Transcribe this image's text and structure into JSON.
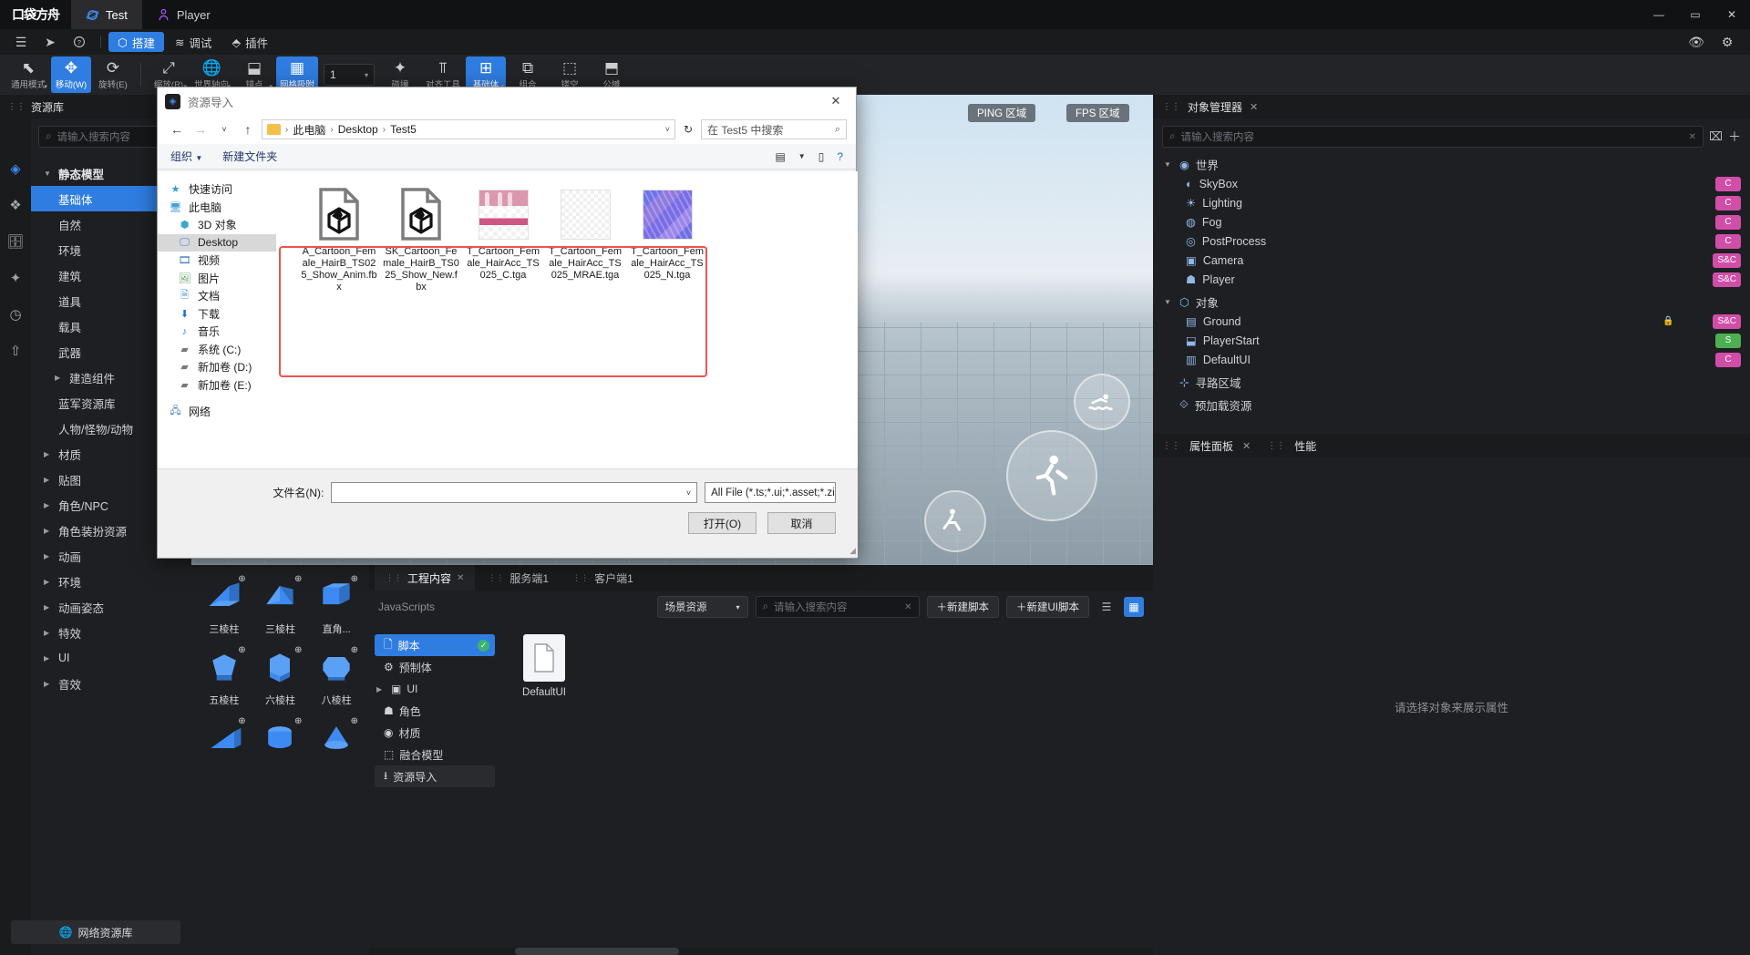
{
  "titlebar": {
    "brand": "口袋方舟",
    "tabs": [
      {
        "label": "Test",
        "icon": "planet-icon",
        "active": true
      },
      {
        "label": "Player",
        "icon": "avatar-icon",
        "active": false
      }
    ],
    "minimize": "—",
    "maximize": "▭",
    "close": "✕"
  },
  "menubar": {
    "hamburger": "☰",
    "send": "➤",
    "help": "?",
    "items": [
      {
        "label": "搭建",
        "icon": "cube-icon",
        "active": true
      },
      {
        "label": "调试",
        "icon": "layers-icon",
        "active": false
      },
      {
        "label": "插件",
        "icon": "plugin-icon",
        "active": false
      }
    ],
    "right": [
      "👁",
      "⚙"
    ]
  },
  "toolbar": {
    "tools": [
      {
        "caption": "通用模式",
        "glyph": "⬉",
        "selected": false,
        "caret": true
      },
      {
        "caption": "移动(W)",
        "glyph": "✥",
        "selected": true,
        "caret": false
      },
      {
        "caption": "旋转(E)",
        "glyph": "⟳",
        "selected": false,
        "caret": false
      },
      {
        "caption": "缩放(R)",
        "glyph": "⤢",
        "selected": false,
        "caret": true
      },
      {
        "caption": "世界轴向",
        "glyph": "🌐",
        "selected": false,
        "caret": true
      },
      {
        "caption": "锚点",
        "glyph": "⬓",
        "selected": false,
        "caret": true
      },
      {
        "caption": "网格吸附",
        "glyph": "▦",
        "selected": true,
        "caret": false
      },
      {
        "caption": "碰撞",
        "glyph": "✦",
        "selected": false,
        "caret": false
      },
      {
        "caption": "对齐工具",
        "glyph": "⫪",
        "selected": false,
        "caret": false
      },
      {
        "caption": "基础体",
        "glyph": "⊞",
        "selected": true,
        "caret": true
      },
      {
        "caption": "组合",
        "glyph": "⧉",
        "selected": false,
        "caret": false
      },
      {
        "caption": "镂空",
        "glyph": "⬚",
        "selected": false,
        "caret": false
      },
      {
        "caption": "公摊",
        "glyph": "⬒",
        "selected": false,
        "caret": false
      }
    ],
    "grid_value": "1"
  },
  "library": {
    "tab_title": "资源库",
    "tab_close": "✕",
    "search_placeholder": "请输入搜索内容",
    "collapse": "«",
    "rail_icons": [
      "cube-stack-icon",
      "grid-icon",
      "briefcase-icon",
      "star-icon",
      "clock-icon",
      "upload-icon"
    ],
    "items": [
      {
        "label": "静态模型",
        "type": "head",
        "tri": "▼"
      },
      {
        "label": "基础体",
        "type": "sel"
      },
      {
        "label": "自然",
        "type": "row"
      },
      {
        "label": "环境",
        "type": "row"
      },
      {
        "label": "建筑",
        "type": "row"
      },
      {
        "label": "道具",
        "type": "row"
      },
      {
        "label": "载具",
        "type": "row"
      },
      {
        "label": "武器",
        "type": "row"
      },
      {
        "label": "建造组件",
        "type": "sub",
        "tri": "▶"
      },
      {
        "label": "蓝军资源库",
        "type": "row"
      },
      {
        "label": "人物/怪物/动物",
        "type": "row"
      },
      {
        "label": "材质",
        "type": "row",
        "tri": "▶"
      },
      {
        "label": "贴图",
        "type": "row",
        "tri": "▶"
      },
      {
        "label": "角色/NPC",
        "type": "row",
        "tri": "▶"
      },
      {
        "label": "角色装扮资源",
        "type": "row",
        "tri": "▶"
      },
      {
        "label": "动画",
        "type": "row",
        "tri": "▶"
      },
      {
        "label": "环境",
        "type": "row",
        "tri": "▶"
      },
      {
        "label": "动画姿态",
        "type": "row",
        "tri": "▶"
      },
      {
        "label": "特效",
        "type": "row",
        "tri": "▶"
      },
      {
        "label": "UI",
        "type": "row",
        "tri": "▶"
      },
      {
        "label": "音效",
        "type": "row",
        "tri": "▶"
      }
    ],
    "net_library": "网络资源库",
    "net_icon": "globe-icon"
  },
  "viewport": {
    "badges": [
      {
        "label": "PING 区域"
      },
      {
        "label": "FPS 区域"
      }
    ],
    "gizmos": [
      "swim-icon",
      "run-icon",
      "crouch-icon"
    ]
  },
  "asset_grid": {
    "cells": [
      {
        "name": "三棱柱",
        "shape": "wedge"
      },
      {
        "name": "三棱柱",
        "shape": "wedge2"
      },
      {
        "name": "直角...",
        "shape": "corner"
      },
      {
        "name": "五棱柱",
        "shape": "penta"
      },
      {
        "name": "六棱柱",
        "shape": "hexa"
      },
      {
        "name": "八棱柱",
        "shape": "octa"
      },
      {
        "name": "",
        "shape": "ramp"
      },
      {
        "name": "",
        "shape": "cyl"
      },
      {
        "name": "",
        "shape": "cone"
      }
    ],
    "zoom_icon": "magnifier-plus-icon"
  },
  "dock": {
    "tabs": [
      {
        "label": "工程内容",
        "active": true,
        "close": "✕"
      },
      {
        "label": "服务端1",
        "active": false
      },
      {
        "label": "客户端1",
        "active": false
      }
    ],
    "subtitle": "JavaScripts",
    "scope_select": "场景资源",
    "search_placeholder": "请输入搜索内容",
    "new_script": "＋新建脚本",
    "new_ui_script": "＋新建UI脚本",
    "view_list_icon": "list-view-icon",
    "view_grid_icon": "grid-view-icon",
    "tree": [
      {
        "label": "脚本",
        "icon": "file-icon",
        "selected": true,
        "check": "✓"
      },
      {
        "label": "预制体",
        "icon": "gear-icon"
      },
      {
        "label": "UI",
        "icon": "ui-icon",
        "tri": "▶"
      },
      {
        "label": "角色",
        "icon": "person-icon"
      },
      {
        "label": "材质",
        "icon": "material-icon"
      },
      {
        "label": "融合模型",
        "icon": "merge-icon"
      },
      {
        "label": "资源导入",
        "icon": "import-icon",
        "highlight": true
      }
    ],
    "files": [
      {
        "name": "DefaultUI",
        "icon": "file-icon"
      }
    ]
  },
  "object_manager": {
    "title": "对象管理器",
    "close": "✕",
    "search_placeholder": "请输入搜索内容",
    "clear": "✕",
    "filter_icon": "filter-icon",
    "add_icon": "plus-icon",
    "rows": [
      {
        "label": "世界",
        "tri": "▼",
        "depth": 0,
        "icon": "globe-icon",
        "tag": "",
        "tagcolor": ""
      },
      {
        "label": "SkyBox",
        "depth": 1,
        "icon": "sky-icon",
        "tag": "C",
        "tagcolor": "#d14ea8"
      },
      {
        "label": "Lighting",
        "depth": 1,
        "icon": "light-icon",
        "tag": "C",
        "tagcolor": "#d14ea8"
      },
      {
        "label": "Fog",
        "depth": 1,
        "icon": "fog-icon",
        "tag": "C",
        "tagcolor": "#d14ea8"
      },
      {
        "label": "PostProcess",
        "depth": 1,
        "icon": "post-icon",
        "tag": "C",
        "tagcolor": "#d14ea8"
      },
      {
        "label": "Camera",
        "depth": 1,
        "icon": "camera-icon",
        "tag": "S&C",
        "tagcolor": "#d14ea8"
      },
      {
        "label": "Player",
        "depth": 1,
        "icon": "player-icon",
        "tag": "S&C",
        "tagcolor": "#d14ea8"
      },
      {
        "label": "对象",
        "tri": "▼",
        "depth": 0,
        "icon": "cube-icon",
        "tag": "",
        "tagcolor": ""
      },
      {
        "label": "Ground",
        "depth": 1,
        "icon": "ground-icon",
        "tag": "S&C",
        "tagcolor": "#d14ea8",
        "lock": "🔒"
      },
      {
        "label": "PlayerStart",
        "depth": 1,
        "icon": "start-icon",
        "tag": "S",
        "tagcolor": "#4caf50"
      },
      {
        "label": "DefaultUI",
        "depth": 1,
        "icon": "ui-icon",
        "tag": "C",
        "tagcolor": "#d14ea8"
      },
      {
        "label": "寻路区域",
        "depth": 0,
        "icon": "nav-icon",
        "tag": "",
        "tagcolor": ""
      },
      {
        "label": "预加载资源",
        "depth": 0,
        "icon": "preload-icon",
        "tag": "",
        "tagcolor": ""
      }
    ]
  },
  "property_panel": {
    "title": "属性面板",
    "close": "✕",
    "perf_tab": "性能",
    "empty_text": "请选择对象来展示属性"
  },
  "dialog": {
    "title": "资源导入",
    "icon": "app-icon",
    "close": "✕",
    "nav": {
      "back": "←",
      "forward": "→",
      "recent": "˅",
      "up": "↑",
      "breadcrumb": [
        "此电脑",
        "Desktop",
        "Test5"
      ],
      "crumb_sep": "›",
      "crumb_dropdown": "˅",
      "reload": "↻",
      "search_placeholder": "在 Test5 中搜索",
      "search_icon": "magnifier-icon"
    },
    "commands": {
      "organize": "组织",
      "organize_caret": "▼",
      "new_folder": "新建文件夹",
      "view_icon": "view-icon",
      "view_caret": "▼",
      "pane_icon": "preview-pane-icon",
      "help_icon": "help-icon"
    },
    "sidebar": [
      {
        "label": "快速访问",
        "icon": "star-icon",
        "indent": 0
      },
      {
        "label": "此电脑",
        "icon": "pc-icon",
        "indent": 0
      },
      {
        "label": "3D 对象",
        "icon": "3d-icon",
        "indent": 1
      },
      {
        "label": "Desktop",
        "icon": "desktop-icon",
        "indent": 1,
        "selected": true
      },
      {
        "label": "视频",
        "icon": "video-icon",
        "indent": 1
      },
      {
        "label": "图片",
        "icon": "picture-icon",
        "indent": 1
      },
      {
        "label": "文档",
        "icon": "document-icon",
        "indent": 1
      },
      {
        "label": "下载",
        "icon": "download-icon",
        "indent": 1
      },
      {
        "label": "音乐",
        "icon": "music-icon",
        "indent": 1
      },
      {
        "label": "系统 (C:)",
        "icon": "drive-system-icon",
        "indent": 1
      },
      {
        "label": "新加卷 (D:)",
        "icon": "drive-icon",
        "indent": 1
      },
      {
        "label": "新加卷 (E:)",
        "icon": "drive-icon",
        "indent": 1
      },
      {
        "label": "网络",
        "icon": "network-icon",
        "indent": 0
      }
    ],
    "files": [
      {
        "name": "A_Cartoon_Female_HairB_TS025_Show_Anim.fbx",
        "thumb": "fbx-doc"
      },
      {
        "name": "SK_Cartoon_Female_HairB_TS025_Show_New.fbx",
        "thumb": "fbx-doc"
      },
      {
        "name": "T_Cartoon_Female_HairAcc_TS025_C.tga",
        "thumb": "tex-pink"
      },
      {
        "name": "T_Cartoon_Female_HairAcc_TS025_MRAE.tga",
        "thumb": "tex-alpha"
      },
      {
        "name": "T_Cartoon_Female_HairAcc_TS025_N.tga",
        "thumb": "tex-normal"
      }
    ],
    "footer": {
      "filename_label": "文件名(N):",
      "filename_value": "",
      "filename_caret": "˅",
      "filetype_value": "All File (*.ts;*.ui;*.asset;*.zip;*.",
      "filetype_caret": "˅",
      "open_button": "打开(O)",
      "cancel_button": "取消"
    },
    "highlight_color": "#ef5350"
  }
}
